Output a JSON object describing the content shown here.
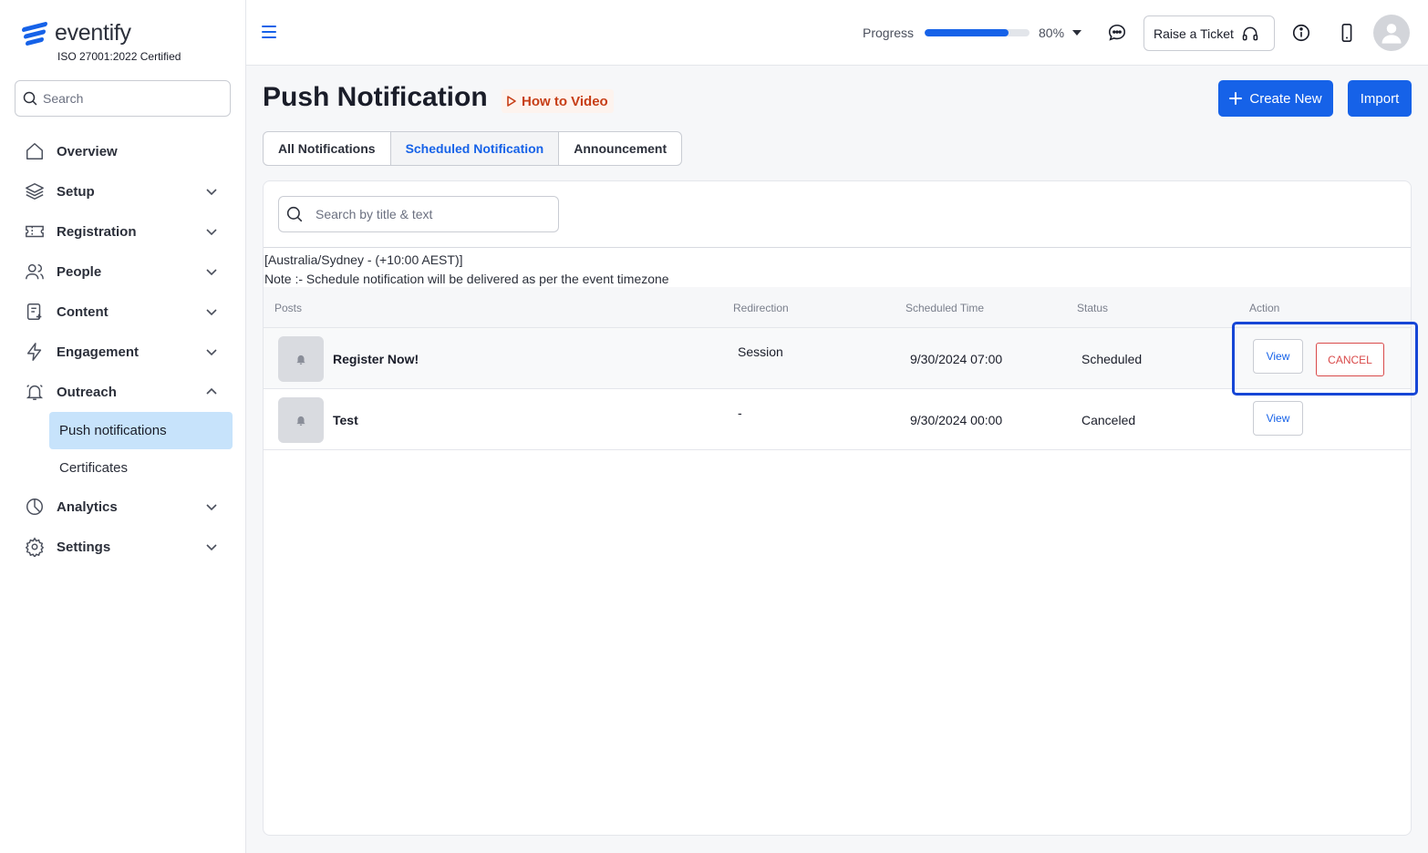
{
  "brand": {
    "name": "eventify",
    "certification": "ISO 27001:2022 Certified"
  },
  "sidebar": {
    "search_placeholder": "Search",
    "items": [
      {
        "label": "Overview",
        "icon": "home-icon"
      },
      {
        "label": "Setup",
        "icon": "layers-icon"
      },
      {
        "label": "Registration",
        "icon": "ticket-icon"
      },
      {
        "label": "People",
        "icon": "users-icon"
      },
      {
        "label": "Content",
        "icon": "document-icon"
      },
      {
        "label": "Engagement",
        "icon": "bolt-icon"
      },
      {
        "label": "Outreach",
        "icon": "bell-icon"
      },
      {
        "label": "Analytics",
        "icon": "pie-chart-icon"
      },
      {
        "label": "Settings",
        "icon": "gear-icon"
      }
    ],
    "outreach_sub": [
      {
        "label": "Push notifications",
        "active": true
      },
      {
        "label": "Certificates",
        "active": false
      }
    ]
  },
  "topbar": {
    "progress_label": "Progress",
    "progress_value": "80%",
    "progress_fraction": 0.8,
    "ticket_label": "Raise a Ticket"
  },
  "page": {
    "title": "Push Notification",
    "how_to_label": "How to Video",
    "create_label": "Create New",
    "import_label": "Import",
    "tabs": [
      {
        "label": "All Notifications",
        "active": false
      },
      {
        "label": "Scheduled Notification",
        "active": true
      },
      {
        "label": "Announcement",
        "active": false
      }
    ],
    "search_placeholder": "Search by title & text",
    "timezone": "[Australia/Sydney - (+10:00 AEST)]",
    "note": "Note :- Schedule notification will be delivered as per the event timezone"
  },
  "table": {
    "headers": [
      "Posts",
      "Redirection",
      "Scheduled Time",
      "Status",
      "Action"
    ],
    "rows": [
      {
        "title": "Register Now!",
        "redirection": "Session",
        "time": "9/30/2024 07:00",
        "status": "Scheduled",
        "view": "View",
        "cancel": "CANCEL"
      },
      {
        "title": "Test",
        "redirection": "-",
        "time": "9/30/2024 00:00",
        "status": "Canceled",
        "view": "View"
      }
    ]
  },
  "colors": {
    "accent": "#1662e8",
    "danger": "#d94a4a",
    "video": "#c73e16",
    "active_nav": "#c7e3fb"
  }
}
